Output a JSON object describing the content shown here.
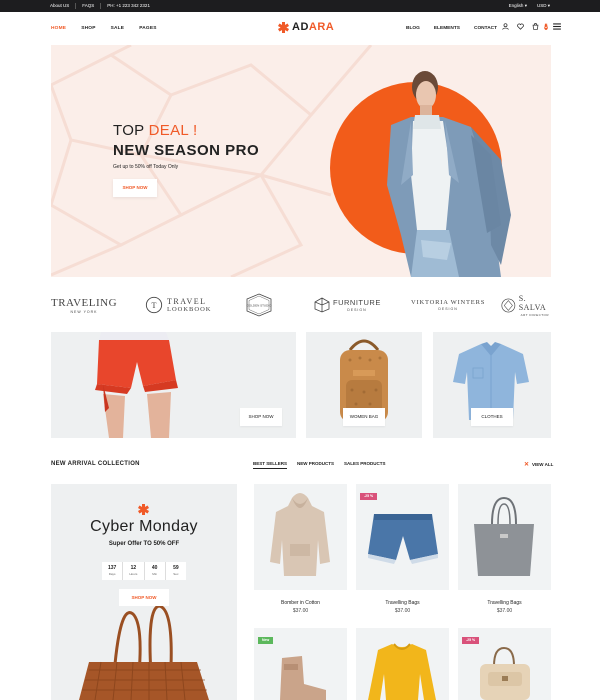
{
  "topbar": {
    "links": [
      "About US",
      "FAQS",
      "PH: +1 223 342 2321"
    ],
    "language": "English",
    "currency": "USD"
  },
  "nav": {
    "left": [
      "HOME",
      "SHOP",
      "SALE",
      "PAGES"
    ],
    "right": [
      "BLOG",
      "ELEMENTS",
      "CONTACT"
    ],
    "cart_count": "0"
  },
  "logo": {
    "part1": "AD",
    "part2": "ARA"
  },
  "hero": {
    "deal_prefix": "TOP",
    "deal_highlight": "DEAL !",
    "title": "NEW SEASON PRO",
    "subtitle": "Get up to 50% off Today Only",
    "button": "SHOP NOW"
  },
  "brands": [
    {
      "name": "TRAVELING",
      "sub": "NEW YORK"
    },
    {
      "name": "TRAVEL",
      "sub": "LOOKBOOK",
      "badge": "T"
    },
    {
      "name": "GOLDEN STUDIO",
      "sub": ""
    },
    {
      "name": "FURNITURE",
      "sub": "DESIGN"
    },
    {
      "name": "VIKTORIA WINTERS",
      "sub": "DESIGN"
    },
    {
      "name": "S. SALVA",
      "sub": "ART DIRECTOR"
    }
  ],
  "categories": {
    "shop_now": "SHOP NOW",
    "women_bag": "WOMEN BAG",
    "clothes": "CLOTHES"
  },
  "arrivals": {
    "title": "NEW ARRIVAL COLLECTION",
    "tabs": [
      "BEST SELLERS",
      "NEW PRODUCTS",
      "SALES PRODUCTS"
    ],
    "view_all": "VIEW ALL"
  },
  "promo": {
    "title": "Cyber Monday",
    "subtitle": "Super Offer TO 50% OFF",
    "timer": [
      {
        "value": "137",
        "label": "Days"
      },
      {
        "value": "12",
        "label": "Hours"
      },
      {
        "value": "40",
        "label": "Min"
      },
      {
        "value": "59",
        "label": "Sec"
      }
    ],
    "button": "SHOP NOW"
  },
  "products": [
    {
      "name": "Bomber in Cotton",
      "price": "$37.00",
      "tag": ""
    },
    {
      "name": "Travelling Bags",
      "price": "$37.00",
      "tag": "-25 %"
    },
    {
      "name": "Travelling Bags",
      "price": "$37.00",
      "tag": ""
    },
    {
      "name": "",
      "price": "",
      "tag": "New"
    },
    {
      "name": "",
      "price": "",
      "tag": ""
    },
    {
      "name": "",
      "price": "",
      "tag": "-25 %"
    }
  ],
  "colors": {
    "accent": "#f05a28",
    "sale_tag": "#d9517a",
    "new_tag": "#5cb85c"
  }
}
